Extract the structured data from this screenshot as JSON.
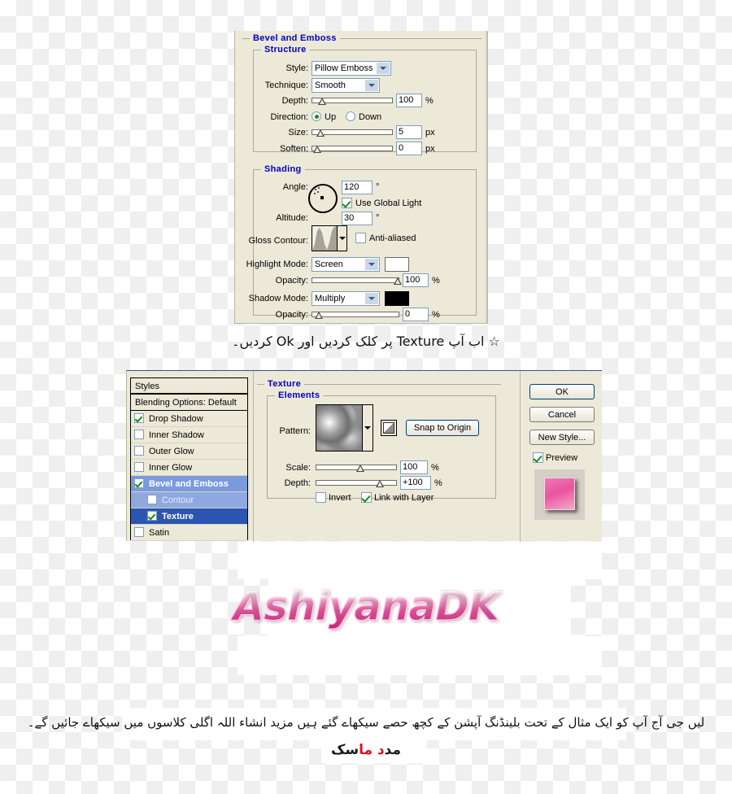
{
  "dialog1": {
    "title": "Bevel and Emboss",
    "structure": {
      "title": "Structure",
      "style_label": "Style:",
      "style_value": "Pillow Emboss",
      "technique_label": "Technique:",
      "technique_value": "Smooth",
      "depth_label": "Depth:",
      "depth_value": "100",
      "depth_unit": "%",
      "direction_label": "Direction:",
      "direction_up": "Up",
      "direction_down": "Down",
      "direction_selected": "Up",
      "size_label": "Size:",
      "size_value": "5",
      "size_unit": "px",
      "soften_label": "Soften:",
      "soften_value": "0",
      "soften_unit": "px"
    },
    "shading": {
      "title": "Shading",
      "angle_label": "Angle:",
      "angle_value": "120",
      "angle_unit": "°",
      "use_global_light": "Use Global Light",
      "use_global_light_checked": true,
      "altitude_label": "Altitude:",
      "altitude_value": "30",
      "altitude_unit": "°",
      "gloss_contour_label": "Gloss Contour:",
      "anti_aliased": "Anti-aliased",
      "anti_aliased_checked": false,
      "highlight_mode_label": "Highlight Mode:",
      "highlight_mode_value": "Screen",
      "highlight_color": "#ffffff",
      "highlight_opacity_label": "Opacity:",
      "highlight_opacity_value": "100",
      "highlight_opacity_unit": "%",
      "shadow_mode_label": "Shadow Mode:",
      "shadow_mode_value": "Multiply",
      "shadow_color": "#000000",
      "shadow_opacity_label": "Opacity:",
      "shadow_opacity_value": "0",
      "shadow_opacity_unit": "%"
    }
  },
  "caption1": {
    "prefix": "☆",
    "text_part1": "اب آپ",
    "latin1": "Texture",
    "text_part2": "پر کلک کردیں اور",
    "latin2": "Ok",
    "text_part3": "کردیں۔",
    "full": "☆  اب آپ Texture پر کلک کردیں اور Ok کردیں۔"
  },
  "dialog2": {
    "styles": {
      "header": "Styles",
      "blending_options": "Blending Options: Default",
      "items": [
        {
          "label": "Drop Shadow",
          "checked": true,
          "selected": false,
          "indent": 0
        },
        {
          "label": "Inner Shadow",
          "checked": false,
          "selected": false,
          "indent": 0
        },
        {
          "label": "Outer Glow",
          "checked": false,
          "selected": false,
          "indent": 0
        },
        {
          "label": "Inner Glow",
          "checked": false,
          "selected": false,
          "indent": 0
        },
        {
          "label": "Bevel and Emboss",
          "checked": true,
          "selected": true,
          "indent": 0
        },
        {
          "label": "Contour",
          "checked": false,
          "selected": false,
          "indent": 1
        },
        {
          "label": "Texture",
          "checked": true,
          "selected": true,
          "indent": 1
        },
        {
          "label": "Satin",
          "checked": false,
          "selected": false,
          "indent": 0
        }
      ]
    },
    "texture": {
      "title": "Texture",
      "elements_title": "Elements",
      "pattern_label": "Pattern:",
      "snap_to_origin": "Snap to Origin",
      "scale_label": "Scale:",
      "scale_value": "100",
      "scale_unit": "%",
      "depth_label": "Depth:",
      "depth_value": "+100",
      "depth_unit": "%",
      "invert_label": "Invert",
      "invert_checked": false,
      "link_with_layer_label": "Link with Layer",
      "link_with_layer_checked": true
    },
    "buttons": {
      "ok": "OK",
      "cancel": "Cancel",
      "new_style": "New Style...",
      "preview": "Preview",
      "preview_checked": true
    }
  },
  "logo": {
    "text": "AshiyanaDK",
    "accent_color": "#ef4fa0"
  },
  "caption2": {
    "line1": "لیں جی آج آپ کو ایک مثال کے تحت بلینڈنگ آپشن کے کچھ حصے سیکھاے گئے ہیں مزید انشاء اللہ اگلی کلاسوں میں سیکھاے جائیں گے۔"
  },
  "signature": {
    "black_left": "مد",
    "red": "د ما",
    "black_right": "سک"
  }
}
